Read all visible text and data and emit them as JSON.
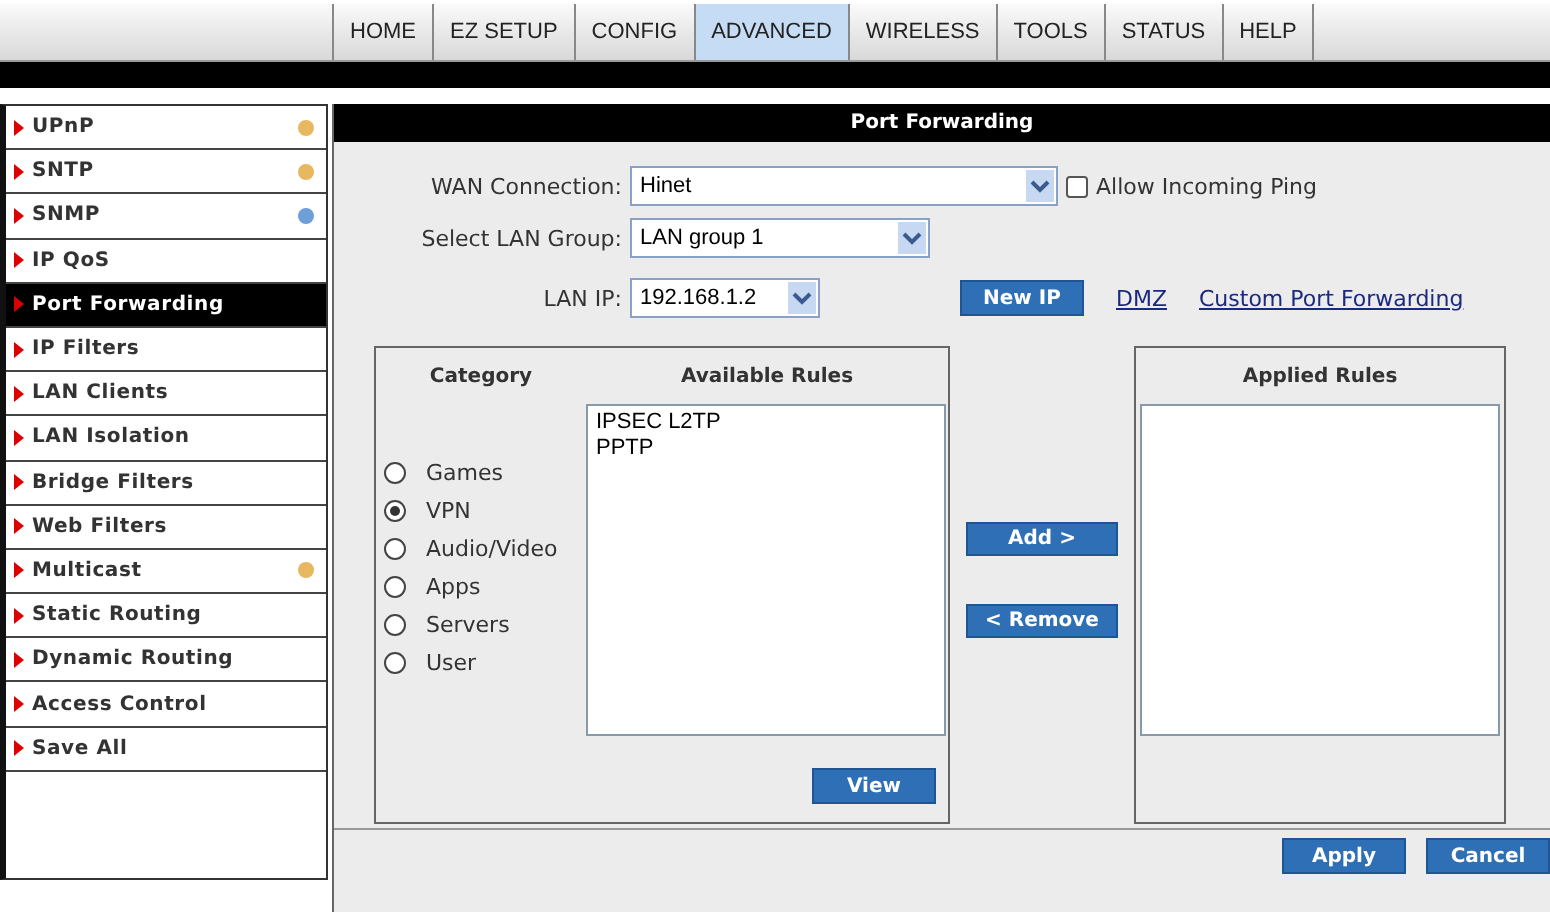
{
  "nav_tabs": [
    {
      "label": "HOME",
      "selected": false
    },
    {
      "label": "EZ SETUP",
      "selected": false
    },
    {
      "label": "CONFIG",
      "selected": false
    },
    {
      "label": "ADVANCED",
      "selected": true
    },
    {
      "label": "WIRELESS",
      "selected": false
    },
    {
      "label": "TOOLS",
      "selected": false
    },
    {
      "label": "STATUS",
      "selected": false
    },
    {
      "label": "HELP",
      "selected": false
    }
  ],
  "sidebar": {
    "items": [
      {
        "label": "UPnP",
        "selected": false,
        "color": "#e8b860"
      },
      {
        "label": "SNTP",
        "selected": false,
        "color": "#e8b860"
      },
      {
        "label": "SNMP",
        "selected": false,
        "color": "#6f9fd8"
      },
      {
        "label": "IP QoS",
        "selected": false
      },
      {
        "label": "Port Forwarding",
        "selected": true
      },
      {
        "label": "IP Filters",
        "selected": false
      },
      {
        "label": "LAN Clients",
        "selected": false
      },
      {
        "label": "LAN Isolation",
        "selected": false
      },
      {
        "label": "Bridge Filters",
        "selected": false
      },
      {
        "label": "Web Filters",
        "selected": false
      },
      {
        "label": "Multicast",
        "selected": false,
        "color": "#e8b860"
      },
      {
        "label": "Static Routing",
        "selected": false
      },
      {
        "label": "Dynamic Routing",
        "selected": false
      },
      {
        "label": "Access Control",
        "selected": false
      },
      {
        "label": "Save All",
        "selected": false
      }
    ]
  },
  "panel": {
    "title": "Port Forwarding",
    "wan_connection": {
      "label": "WAN Connection:",
      "value": "Hinet"
    },
    "allow_ping": {
      "label": "Allow Incoming Ping",
      "checked": false
    },
    "lan_group": {
      "label": "Select LAN Group:",
      "value": "LAN group 1"
    },
    "lan_ip": {
      "label": "LAN IP:",
      "value": "192.168.1.2"
    },
    "new_ip_button": "New IP",
    "links": [
      "DMZ",
      "Custom Port Forwarding"
    ],
    "category": {
      "title": "Category",
      "options": [
        {
          "label": "Games",
          "selected": false
        },
        {
          "label": "VPN",
          "selected": true
        },
        {
          "label": "Audio/Video",
          "selected": false
        },
        {
          "label": "Apps",
          "selected": false
        },
        {
          "label": "Servers",
          "selected": false
        },
        {
          "label": "User",
          "selected": false
        }
      ]
    },
    "available_rules": {
      "title": "Available Rules",
      "items": [
        "IPSEC L2TP",
        "PPTP"
      ]
    },
    "view_button": "View",
    "add_button": "Add >",
    "remove_button": "< Remove",
    "applied_rules": {
      "title": "Applied Rules"
    },
    "buttons": [
      "Apply",
      "Cancel"
    ]
  }
}
